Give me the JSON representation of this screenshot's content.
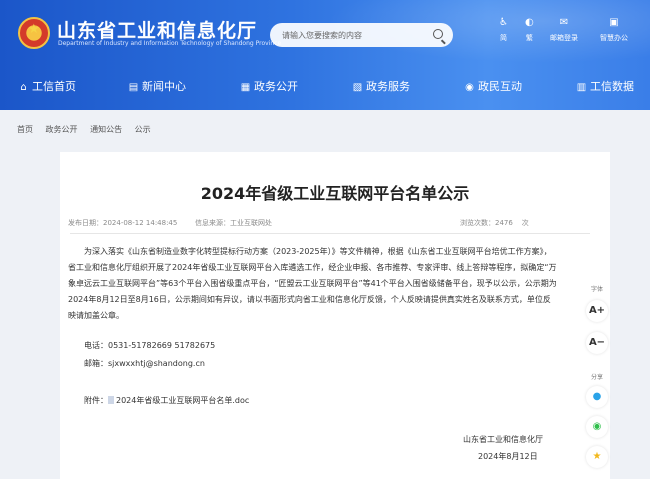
{
  "header": {
    "site_title": "山东省工业和信息化厅",
    "site_subtitle": "Department of Industry and Information Technology of Shandong Province",
    "search_placeholder": "请输入您要搜索的内容",
    "tools": [
      {
        "icon": "♿",
        "label": "简"
      },
      {
        "icon": "◐",
        "label": "繁"
      },
      {
        "icon": "✉",
        "label": "邮箱登录"
      },
      {
        "icon": "▣",
        "label": "智慧办公"
      }
    ]
  },
  "nav": [
    {
      "icon": "⌂",
      "label": "工信首页"
    },
    {
      "icon": "▤",
      "label": "新闻中心"
    },
    {
      "icon": "▦",
      "label": "政务公开"
    },
    {
      "icon": "▧",
      "label": "政务服务"
    },
    {
      "icon": "◉",
      "label": "政民互动"
    },
    {
      "icon": "▥",
      "label": "工信数据"
    }
  ],
  "breadcrumb": [
    "首页",
    "政务公开",
    "通知公告",
    "公示"
  ],
  "article": {
    "title": "2024年省级工业互联网平台名单公示",
    "publish_date": "发布日期：2024-08-12 14:48:45",
    "source": "信息来源：工业互联网处",
    "views_label": "浏览次数：",
    "views": "2476",
    "views_unit": "次",
    "paragraph": "为深入落实《山东省制造业数字化转型提标行动方案（2023-2025年）》等文件精神，根据《山东省工业互联网平台培优工作方案》，省工业和信息化厅组织开展了2024年省级工业互联网平台入库遴选工作，经企业申报、各市推荐、专家评审、线上答辩等程序，拟确定“万象卓远云工业互联网平台”等63个平台入围省级重点平台，“匠盟云工业互联网平台”等41个平台入围省级储备平台，现予以公示，公示期为2024年8月12日至8月16日，公示期间如有异议，请以书面形式向省工业和信息化厅反馈，个人反映请提供真实姓名及联系方式，单位反映请加盖公章。",
    "phone": "电话：0531-51782669 51782675",
    "email": "邮箱：sjxwxxhtj@shandong.cn",
    "attachment_label": "附件：",
    "attachment_name": "2024年省级工业互联网平台名单.doc",
    "signature_org": "山东省工业和信息化厅",
    "signature_date": "2024年8月12日"
  },
  "side_tools": {
    "font_label": "字体",
    "font_larger": "A+",
    "font_smaller": "A−",
    "share_label": "分享",
    "share_icons": [
      "qq-icon",
      "wechat-icon",
      "favorite-star-icon"
    ]
  }
}
